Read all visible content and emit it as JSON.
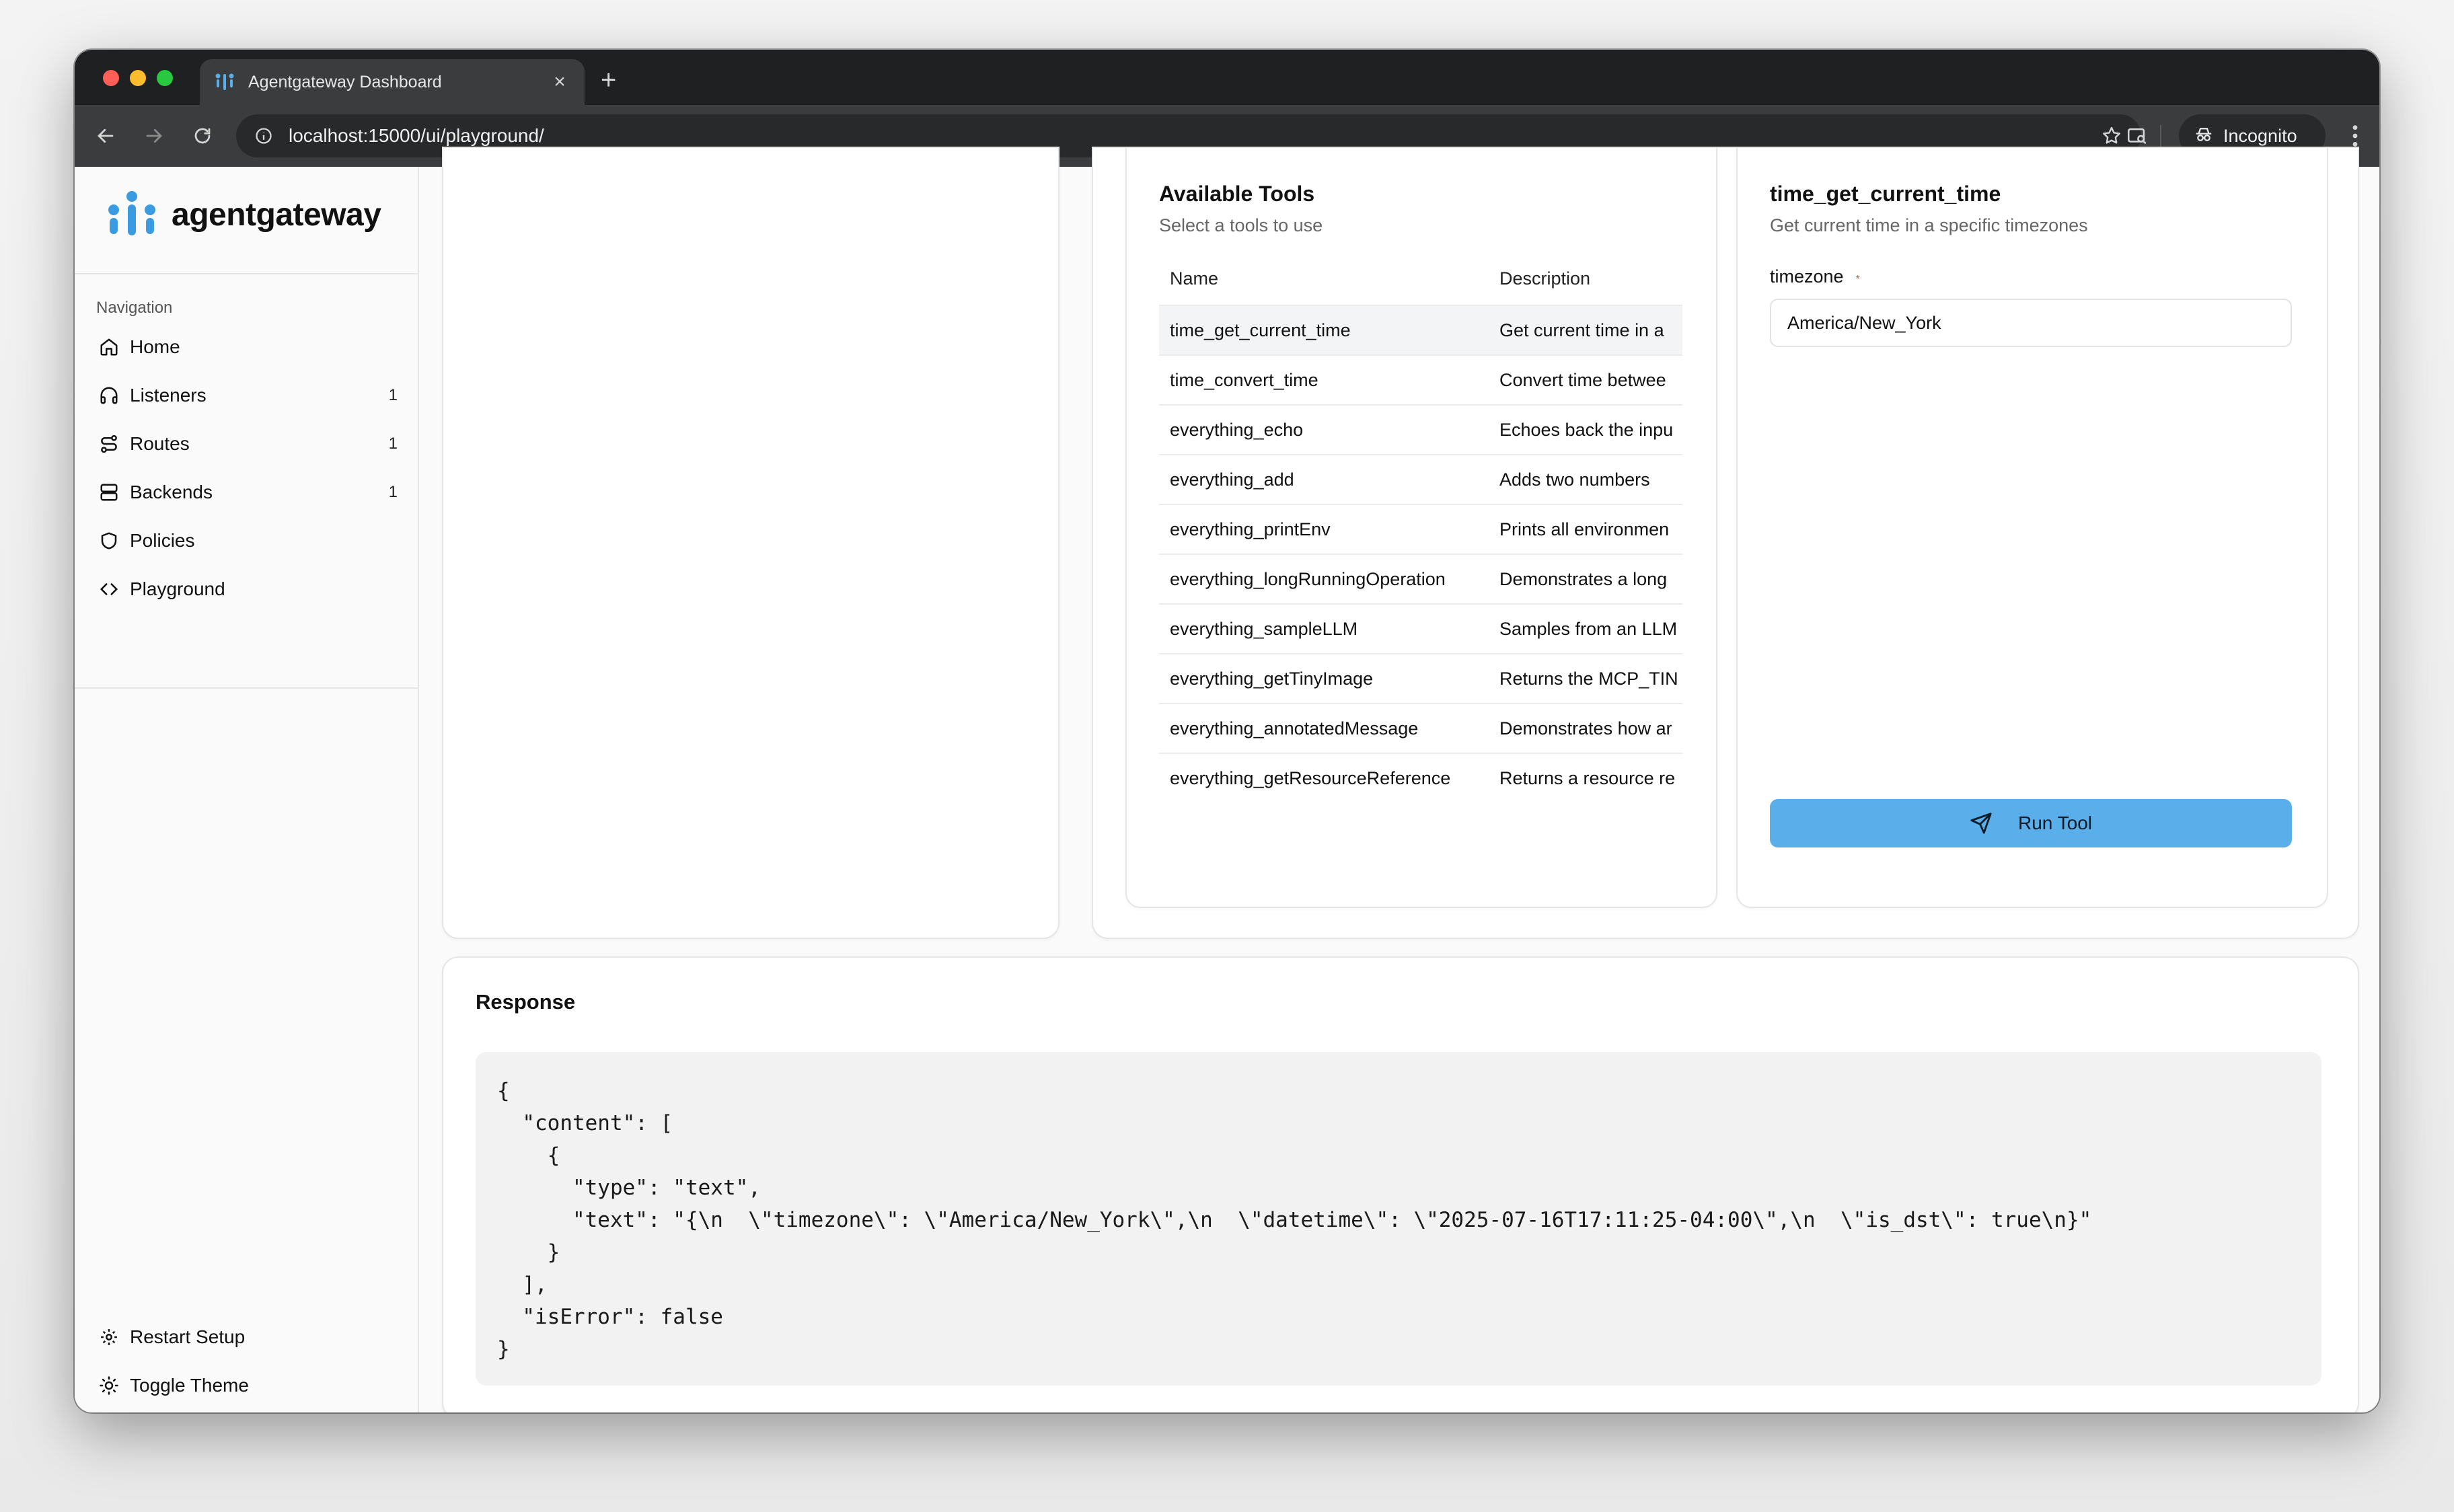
{
  "browser": {
    "tab_title": "Agentgateway Dashboard",
    "url": "localhost:15000/ui/playground/",
    "incognito_label": "Incognito"
  },
  "sidebar": {
    "brand": "agentgateway",
    "nav_label": "Navigation",
    "items": [
      {
        "label": "Home",
        "count": "",
        "icon": "home-icon"
      },
      {
        "label": "Listeners",
        "count": "1",
        "icon": "headphones-icon"
      },
      {
        "label": "Routes",
        "count": "1",
        "icon": "route-icon"
      },
      {
        "label": "Backends",
        "count": "1",
        "icon": "server-icon"
      },
      {
        "label": "Policies",
        "count": "",
        "icon": "shield-icon"
      },
      {
        "label": "Playground",
        "count": "",
        "icon": "code-icon"
      }
    ],
    "bottom_items": [
      {
        "label": "Restart Setup",
        "icon": "gear-icon"
      },
      {
        "label": "Toggle Theme",
        "icon": "sun-icon"
      }
    ]
  },
  "tools": {
    "title": "Available Tools",
    "subtitle": "Select a tools to use",
    "columns": [
      "Name",
      "Description"
    ],
    "rows": [
      {
        "name": "time_get_current_time",
        "description": "Get current time in a"
      },
      {
        "name": "time_convert_time",
        "description": "Convert time betwee"
      },
      {
        "name": "everything_echo",
        "description": "Echoes back the inpu"
      },
      {
        "name": "everything_add",
        "description": "Adds two numbers"
      },
      {
        "name": "everything_printEnv",
        "description": "Prints all environmen"
      },
      {
        "name": "everything_longRunningOperation",
        "description": "Demonstrates a long"
      },
      {
        "name": "everything_sampleLLM",
        "description": "Samples from an LLM"
      },
      {
        "name": "everything_getTinyImage",
        "description": "Returns the MCP_TIN"
      },
      {
        "name": "everything_annotatedMessage",
        "description": "Demonstrates how ar"
      },
      {
        "name": "everything_getResourceReference",
        "description": "Returns a resource re"
      }
    ],
    "selected_index": 0
  },
  "tool_form": {
    "title": "time_get_current_time",
    "subtitle": "Get current time in a specific timezones",
    "field_label": "timezone",
    "required_mark": "*",
    "field_value": "America/New_York",
    "run_label": "Run Tool"
  },
  "response": {
    "title": "Response",
    "body": "{\n  \"content\": [\n    {\n      \"type\": \"text\",\n      \"text\": \"{\\n  \\\"timezone\\\": \\\"America/New_York\\\",\\n  \\\"datetime\\\": \\\"2025-07-16T17:11:25-04:00\\\",\\n  \\\"is_dst\\\": true\\n}\"\n    }\n  ],\n  \"isError\": false\n}"
  },
  "colors": {
    "accent": "#5aaeea",
    "brand_blue": "#3a9be0",
    "required": "#e5484d"
  }
}
